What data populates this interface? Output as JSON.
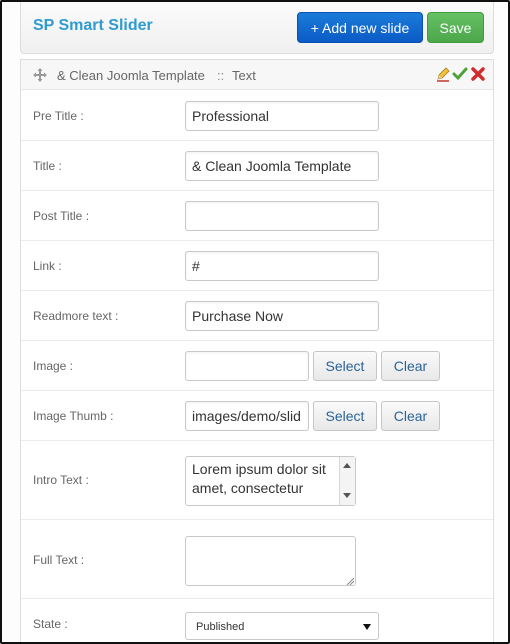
{
  "header": {
    "title": "SP Smart Slider",
    "add_button": "+ Add new slide",
    "save_button": "Save"
  },
  "slide": {
    "name": "& Clean Joomla Template",
    "separator": "::",
    "type": "Text",
    "icons": [
      "move-icon",
      "edit-icon",
      "check-icon",
      "delete-icon"
    ]
  },
  "form": {
    "pre_title": {
      "label": "Pre Title :",
      "value": "Professional"
    },
    "title": {
      "label": "Title :",
      "value": "& Clean Joomla Template"
    },
    "post_title": {
      "label": "Post Title :",
      "value": ""
    },
    "link": {
      "label": "Link :",
      "value": "#"
    },
    "readmore": {
      "label": "Readmore text :",
      "value": "Purchase Now"
    },
    "image": {
      "label": "Image :",
      "value": "",
      "select": "Select",
      "clear": "Clear"
    },
    "image_thumb": {
      "label": "Image Thumb :",
      "value": "images/demo/slid",
      "select": "Select",
      "clear": "Clear"
    },
    "intro_text": {
      "label": "Intro Text :",
      "value": "Lorem ipsum dolor sit amet, consectetur"
    },
    "full_text": {
      "label": "Full Text :",
      "value": ""
    },
    "state": {
      "label": "State :",
      "value": "Published"
    }
  },
  "colors": {
    "title": "#2f9bd1",
    "primary": "#0b5bc6",
    "success": "#4ca64a",
    "link": "#2a6496"
  }
}
